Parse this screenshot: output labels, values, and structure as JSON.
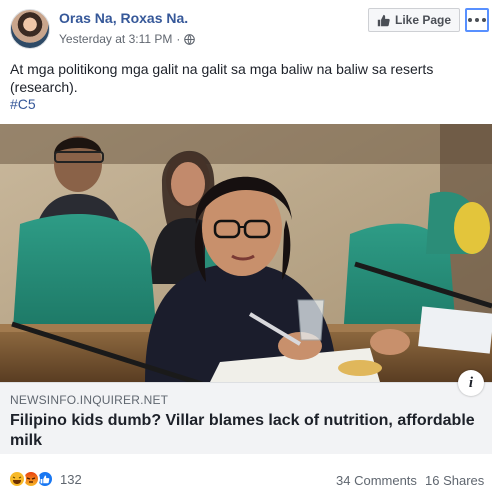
{
  "post": {
    "page_name": "Oras Na, Roxas Na.",
    "timestamp": "Yesterday at 3:11 PM",
    "separator": "·",
    "text": "At mga politikong mga galit na galit sa mga baliw na baliw sa reserts (research).",
    "hashtag": "#C5"
  },
  "actions": {
    "like_page_label": "Like Page"
  },
  "link": {
    "domain": "NEWSINFO.INQUIRER.NET",
    "headline": "Filipino kids dumb? Villar blames lack of nutrition, affordable milk",
    "info_label": "i"
  },
  "stats": {
    "reactions": [
      "haha",
      "angry",
      "like"
    ],
    "reaction_count": "132",
    "comments": "34 Comments",
    "shares": "16 Shares"
  },
  "colors": {
    "link_blue": "#365899",
    "focus_ring": "#5890ff",
    "like_reaction": "#1877f2",
    "haha_reaction": "#f7b928",
    "angry_reaction": "#e9710f"
  }
}
